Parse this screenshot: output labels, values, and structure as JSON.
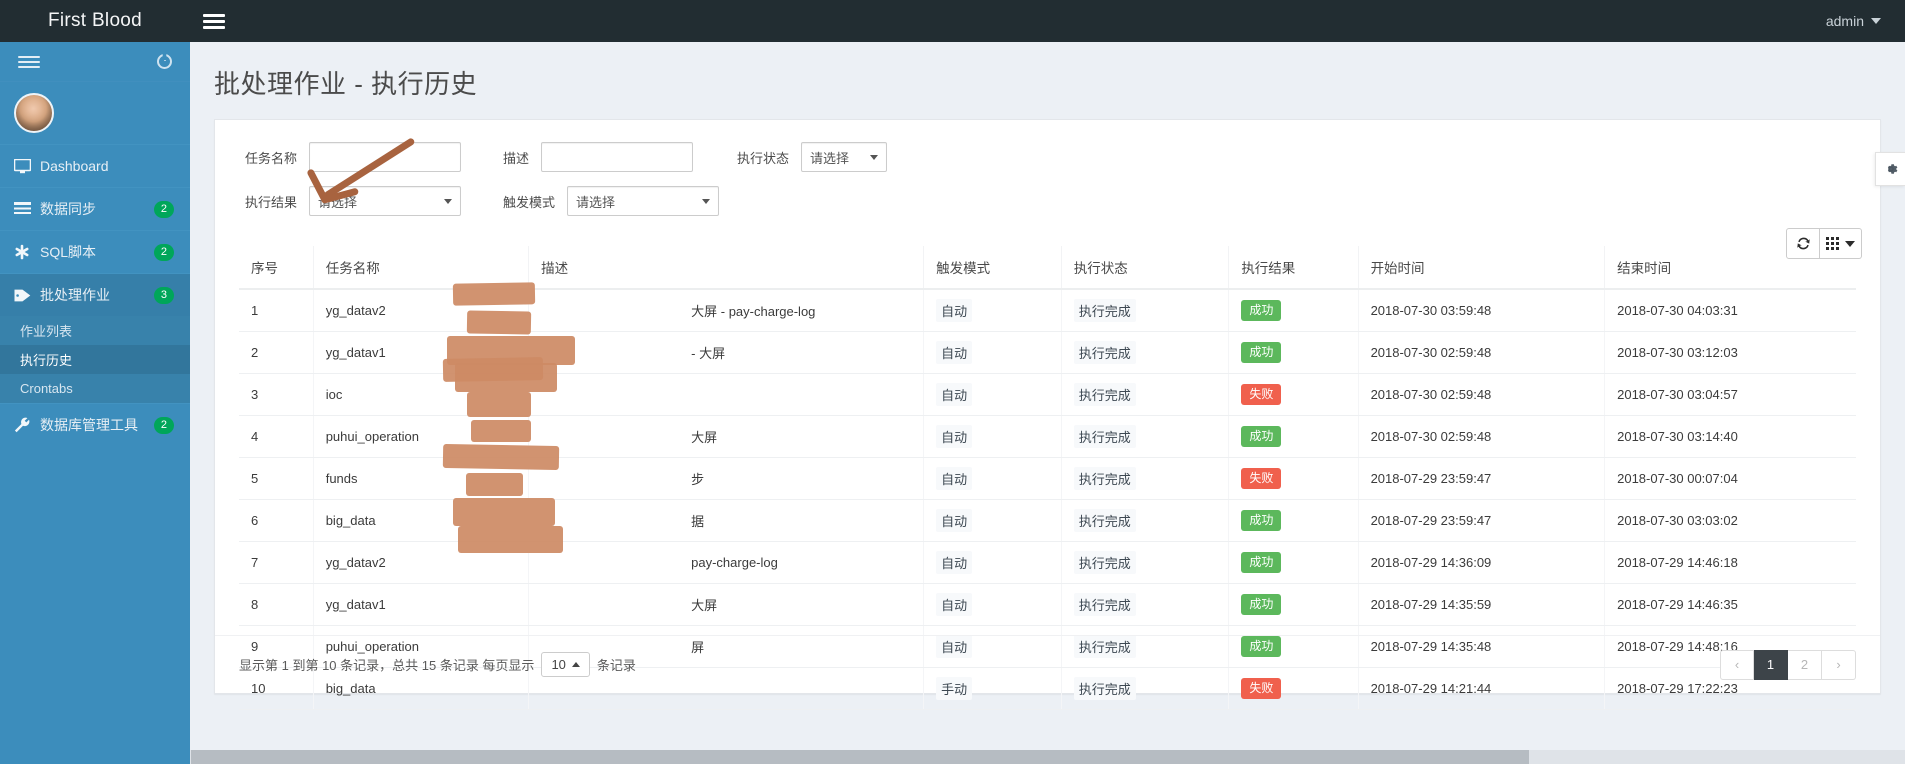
{
  "topbar": {
    "brand": "First Blood",
    "toggle_icon": "hamburger-icon",
    "user": "admin"
  },
  "sidebar": {
    "toggle_icon": "hamburger-icon",
    "power_icon": "power-icon",
    "items": [
      {
        "label": "Dashboard",
        "icon": "monitor-icon",
        "badge": "",
        "active": false
      },
      {
        "label": "数据同步",
        "icon": "list-icon",
        "badge": "2",
        "active": false
      },
      {
        "label": "SQL脚本",
        "icon": "asterisk-icon",
        "badge": "2",
        "active": false
      },
      {
        "label": "批处理作业",
        "icon": "tag-icon",
        "badge": "3",
        "active": true
      }
    ],
    "subitems": [
      {
        "label": "作业列表",
        "active": false
      },
      {
        "label": "执行历史",
        "active": true
      },
      {
        "label": "Crontabs",
        "active": false
      }
    ],
    "items_after": [
      {
        "label": "数据库管理工具",
        "icon": "wrench-icon",
        "badge": "2",
        "active": false
      }
    ]
  },
  "page": {
    "title": "批处理作业 - 执行历史"
  },
  "filter": {
    "task_name_label": "任务名称",
    "task_name_value": "",
    "task_name_placeholder": "",
    "desc_label": "描述",
    "desc_value": "",
    "desc_placeholder": "",
    "exec_status_label": "执行状态",
    "exec_status_value": "请选择",
    "exec_result_label": "执行结果",
    "exec_result_value": "请选择",
    "trigger_mode_label": "触发模式",
    "trigger_mode_value": "请选择"
  },
  "toolbar": {
    "refresh_icon": "refresh-icon",
    "columns_icon": "grid-icon",
    "settings_icon": "gear-icon"
  },
  "table": {
    "columns": [
      "序号",
      "任务名称",
      "描述",
      "触发模式",
      "执行状态",
      "执行结果",
      "开始时间",
      "结束时间"
    ],
    "rows": [
      {
        "idx": "1",
        "name": "yg_datav2",
        "desc": "大屏 - pay-charge-log",
        "trigger": "自动",
        "status": "执行完成",
        "result": "成功",
        "result_type": "success",
        "start": "2018-07-30 03:59:48",
        "end": "2018-07-30 04:03:31"
      },
      {
        "idx": "2",
        "name": "yg_datav1",
        "desc": "- 大屏",
        "trigger": "自动",
        "status": "执行完成",
        "result": "成功",
        "result_type": "success",
        "start": "2018-07-30 02:59:48",
        "end": "2018-07-30 03:12:03"
      },
      {
        "idx": "3",
        "name": "ioc",
        "desc": "",
        "trigger": "自动",
        "status": "执行完成",
        "result": "失败",
        "result_type": "danger",
        "start": "2018-07-30 02:59:48",
        "end": "2018-07-30 03:04:57"
      },
      {
        "idx": "4",
        "name": "puhui_operation",
        "desc": "大屏",
        "trigger": "自动",
        "status": "执行完成",
        "result": "成功",
        "result_type": "success",
        "start": "2018-07-30 02:59:48",
        "end": "2018-07-30 03:14:40"
      },
      {
        "idx": "5",
        "name": "funds",
        "desc": "步",
        "trigger": "自动",
        "status": "执行完成",
        "result": "失败",
        "result_type": "danger",
        "start": "2018-07-29 23:59:47",
        "end": "2018-07-30 00:07:04"
      },
      {
        "idx": "6",
        "name": "big_data",
        "desc": "据",
        "trigger": "自动",
        "status": "执行完成",
        "result": "成功",
        "result_type": "success",
        "start": "2018-07-29 23:59:47",
        "end": "2018-07-30 03:03:02"
      },
      {
        "idx": "7",
        "name": "yg_datav2",
        "desc": "pay-charge-log",
        "trigger": "自动",
        "status": "执行完成",
        "result": "成功",
        "result_type": "success",
        "start": "2018-07-29 14:36:09",
        "end": "2018-07-29 14:46:18"
      },
      {
        "idx": "8",
        "name": "yg_datav1",
        "desc": "大屏",
        "trigger": "自动",
        "status": "执行完成",
        "result": "成功",
        "result_type": "success",
        "start": "2018-07-29 14:35:59",
        "end": "2018-07-29 14:46:35"
      },
      {
        "idx": "9",
        "name": "puhui_operation",
        "desc": "屏",
        "trigger": "自动",
        "status": "执行完成",
        "result": "成功",
        "result_type": "success",
        "start": "2018-07-29 14:35:48",
        "end": "2018-07-29 14:48:16"
      },
      {
        "idx": "10",
        "name": "big_data",
        "desc": "",
        "trigger": "手动",
        "status": "执行完成",
        "result": "失败",
        "result_type": "danger",
        "start": "2018-07-29 14:21:44",
        "end": "2018-07-29 17:22:23"
      }
    ]
  },
  "footer": {
    "info_prefix": "显示第 1 到第 10 条记录，总共 15 条记录 每页显示",
    "page_size": "10",
    "info_suffix": "条记录",
    "pager": {
      "prev": "‹",
      "pages": [
        "1",
        "2"
      ],
      "next": "›",
      "current": "1"
    }
  },
  "colors": {
    "sidebar": "#3c8dbc",
    "topbar": "#222d32",
    "badge": "#00a65a",
    "success": "#5cb85c",
    "danger": "#f0604d",
    "redaction": "#cd8a64",
    "arrow": "#a8633f"
  }
}
